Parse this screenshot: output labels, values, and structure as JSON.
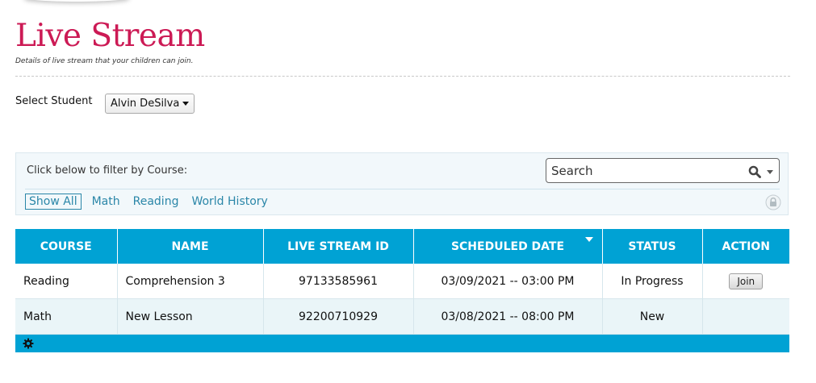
{
  "page": {
    "title": "Live Stream",
    "subtitle": "Details of live stream that your children can join."
  },
  "student": {
    "label": "Select Student",
    "selected": "Alvin DeSilva"
  },
  "filter": {
    "label": "Click below to filter by Course:",
    "search_placeholder": "Search",
    "links": [
      "Show All",
      "Math",
      "Reading",
      "World History"
    ],
    "active": "Show All"
  },
  "table": {
    "columns": [
      "COURSE",
      "NAME",
      "LIVE STREAM ID",
      "SCHEDULED DATE",
      "STATUS",
      "ACTION"
    ],
    "sorted_column": "SCHEDULED DATE",
    "sort_direction": "descending",
    "rows": [
      {
        "course": "Reading",
        "name": "Comprehension 3",
        "stream_id": "97133585961",
        "date": "03/09/2021 -- 03:00 PM",
        "status": "In Progress",
        "action": "Join"
      },
      {
        "course": "Math",
        "name": "New Lesson",
        "stream_id": "92200710929",
        "date": "03/08/2021 -- 08:00 PM",
        "status": "New",
        "action": ""
      }
    ]
  },
  "icons": {
    "search": "search-icon",
    "lock": "lock-icon",
    "settings": "gear-icon"
  },
  "colors": {
    "title": "#cc1a55",
    "table_header": "#00a2d4",
    "link": "#2a86a8"
  }
}
